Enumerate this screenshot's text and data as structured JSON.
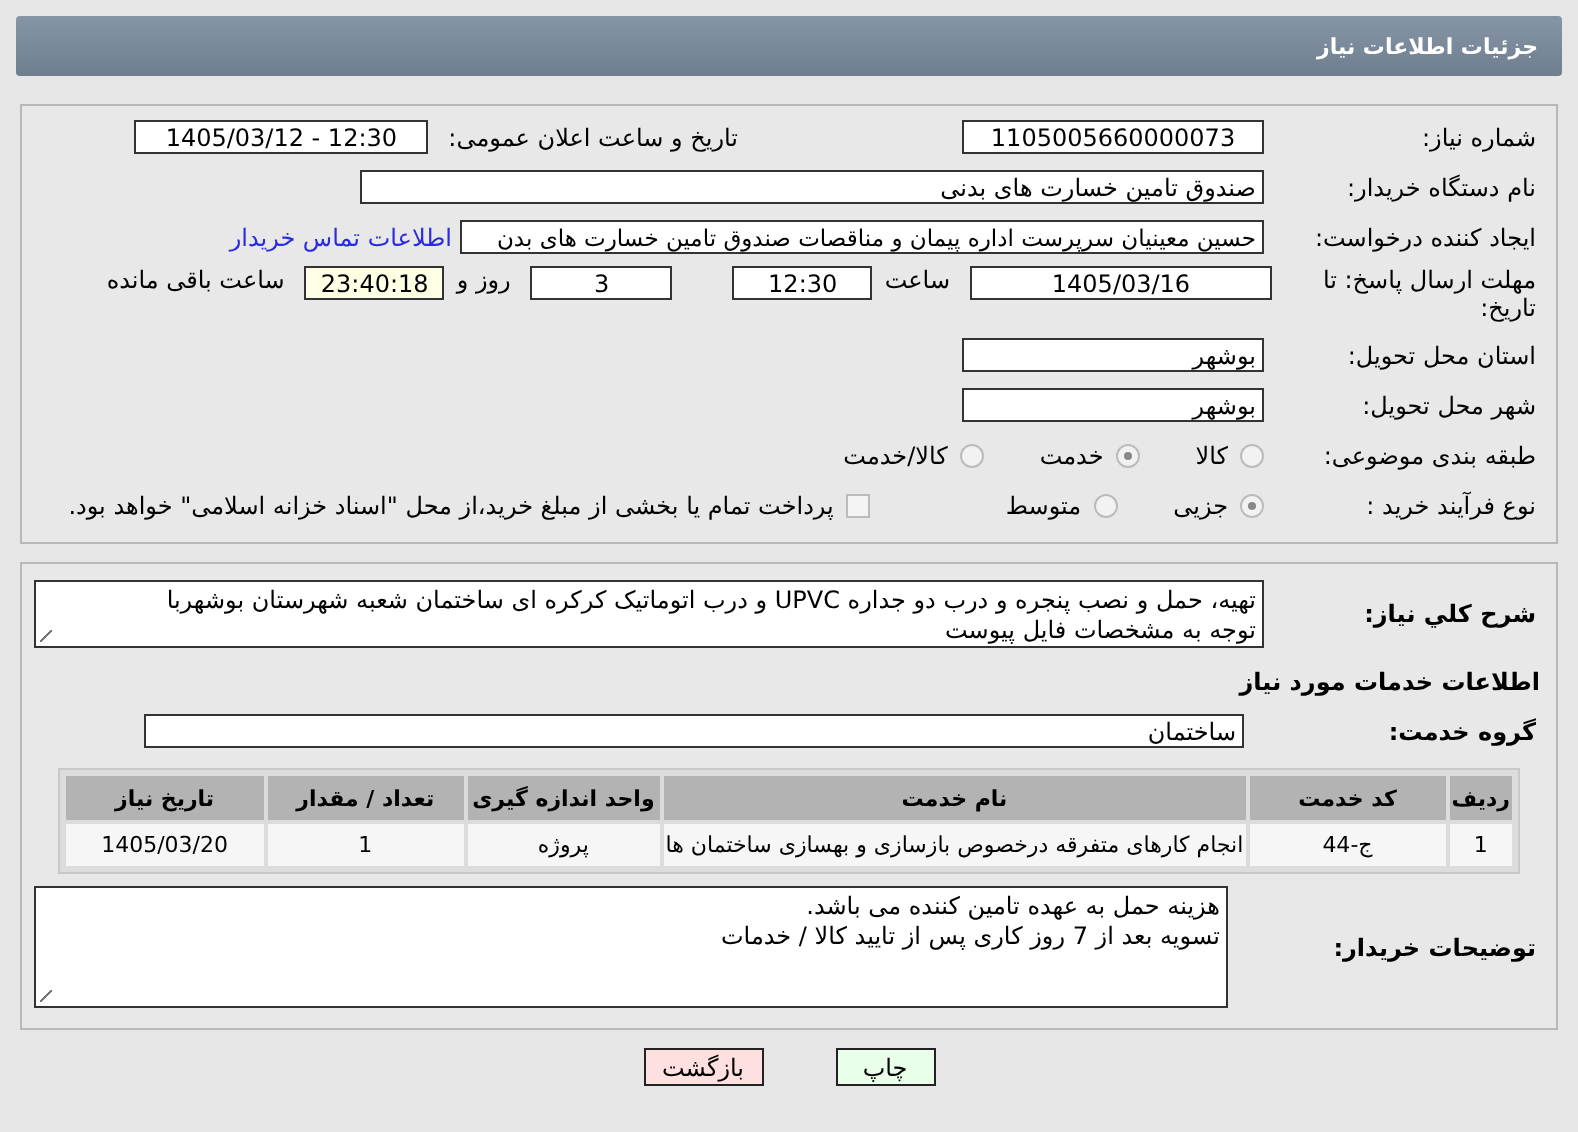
{
  "header": {
    "title": "جزئیات اطلاعات نیاز"
  },
  "need_number": {
    "label": "شماره نیاز:",
    "value": "1105005660000073"
  },
  "announce": {
    "label": "تاریخ و ساعت اعلان عمومی:",
    "value": "1405/03/12 - 12:30"
  },
  "buyer_org": {
    "label": "نام دستگاه خریدار:",
    "value": "صندوق تامین خسارت های بدنی"
  },
  "requester": {
    "label": "ایجاد کننده درخواست:",
    "value": "حسین  معینیان سرپرست اداره پیمان و مناقصات صندوق تامین خسارت های بدن",
    "link": "اطلاعات تماس خریدار"
  },
  "deadline": {
    "label": "مهلت ارسال پاسخ: تا تاریخ:",
    "date": "1405/03/16",
    "time_label": "ساعت",
    "time": "12:30",
    "days": "3",
    "days_label": "روز و",
    "remaining": "23:40:18",
    "remaining_label": "ساعت باقی مانده"
  },
  "province": {
    "label": "استان محل تحویل:",
    "value": "بوشهر"
  },
  "city": {
    "label": "شهر محل تحویل:",
    "value": "بوشهر"
  },
  "category": {
    "label": "طبقه بندی موضوعی:",
    "options": [
      {
        "label": "کالا",
        "selected": false
      },
      {
        "label": "خدمت",
        "selected": true
      },
      {
        "label": "کالا/خدمت",
        "selected": false
      }
    ]
  },
  "process": {
    "label": "نوع فرآیند خرید :",
    "options": [
      {
        "label": "جزیی",
        "selected": true
      },
      {
        "label": "متوسط",
        "selected": false
      }
    ],
    "treasury": {
      "checked": false,
      "label": "پرداخت تمام یا بخشی از مبلغ خرید،از محل \"اسناد خزانه اسلامی\" خواهد بود."
    }
  },
  "description": {
    "label": "شرح کلي نياز:",
    "value": "تهیه، حمل  و نصب پنجره و درب دو جداره UPVC و درب اتوماتیک کرکره ای ساختمان شعبه شهرستان بوشهربا\nتوجه به مشخصات فایل پیوست"
  },
  "services_heading": "اطلاعات خدمات مورد نیاز",
  "service_group": {
    "label": "گروه خدمت:",
    "value": "ساختمان"
  },
  "table": {
    "columns": [
      "ردیف",
      "کد خدمت",
      "نام خدمت",
      "واحد اندازه گیری",
      "تعداد / مقدار",
      "تاریخ نیاز"
    ],
    "rows": [
      [
        "1",
        "ج-44",
        "انجام کارهای متفرقه درخصوص بازسازی و بهسازی ساختمان ها",
        "پروژه",
        "1",
        "1405/03/20"
      ]
    ]
  },
  "buyer_notes": {
    "label": "توضیحات خریدار:",
    "value": "هزینه حمل به عهده تامین کننده می باشد.\nتسویه بعد از 7 روز کاری پس از تایید کالا / خدمات"
  },
  "buttons": [
    {
      "label": "چاپ",
      "kind": "print"
    },
    {
      "label": "بازگشت",
      "kind": "back"
    }
  ]
}
